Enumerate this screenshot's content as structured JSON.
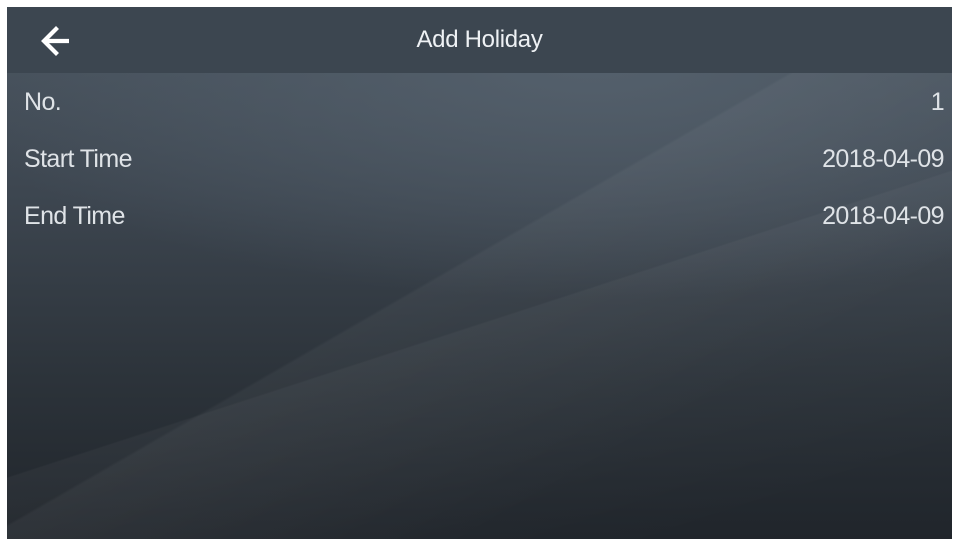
{
  "header": {
    "title": "Add Holiday",
    "back_icon": "arrow-left-icon"
  },
  "fields": [
    {
      "label": "No.",
      "value": "1"
    },
    {
      "label": "Start Time",
      "value": "2018-04-09"
    },
    {
      "label": "End Time",
      "value": "2018-04-09"
    }
  ],
  "colors": {
    "header_bg": "#3c4650",
    "text": "#dfe3e7",
    "title_text": "#eef1f4"
  }
}
